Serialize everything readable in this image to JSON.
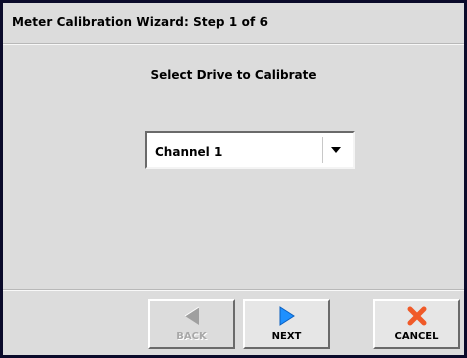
{
  "window": {
    "title": "Meter Calibration Wizard:  Step 1 of 6"
  },
  "main": {
    "heading": "Select Drive to Calibrate",
    "drive_select": {
      "selected": "Channel 1"
    }
  },
  "footer": {
    "back_label": "BACK",
    "next_label": "NEXT",
    "cancel_label": "CANCEL"
  },
  "icons": {
    "back": "back-arrow-icon",
    "next": "next-arrow-icon",
    "cancel": "cancel-x-icon",
    "dropdown": "chevron-down-icon"
  },
  "colors": {
    "next_arrow": "#1e90ff",
    "cancel_x": "#f05a28",
    "disabled_arrow": "#a0a0a0",
    "window_border": "#0a0a2a"
  }
}
